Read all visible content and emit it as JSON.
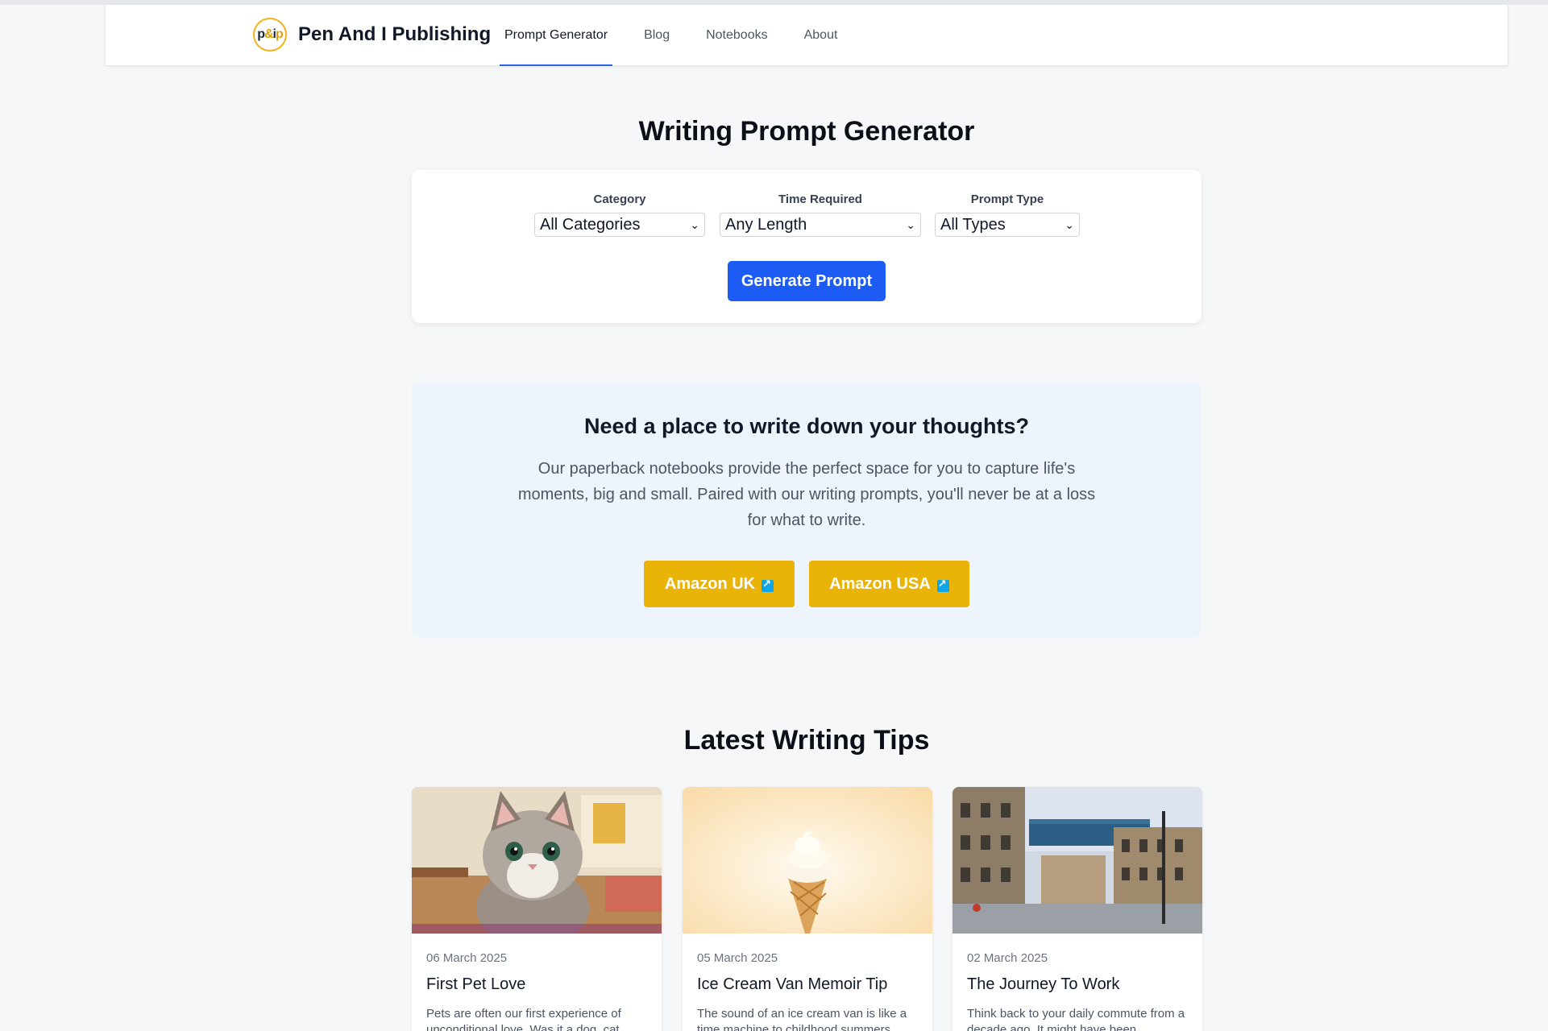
{
  "nav": {
    "logo_text": "p&ip",
    "brand": "Pen And I Publishing",
    "links": [
      {
        "label": "Prompt Generator",
        "active": true
      },
      {
        "label": "Blog",
        "active": false
      },
      {
        "label": "Notebooks",
        "active": false
      },
      {
        "label": "About",
        "active": false
      }
    ]
  },
  "generator": {
    "title": "Writing Prompt Generator",
    "filters": [
      {
        "label": "Category",
        "value": "All Categories"
      },
      {
        "label": "Time Required",
        "value": "Any Length"
      },
      {
        "label": "Prompt Type",
        "value": "All Types"
      }
    ],
    "button": "Generate Prompt"
  },
  "promo": {
    "title": "Need a place to write down your thoughts?",
    "text": "Our paperback notebooks provide the perfect space for you to capture life's moments, big and small. Paired with our writing prompts, you'll never be at a loss for what to write.",
    "buttons": [
      "Amazon UK",
      "Amazon USA"
    ]
  },
  "tips": {
    "title": "Latest Writing Tips",
    "posts": [
      {
        "date": "06 March 2025",
        "title": "First Pet Love",
        "excerpt": "Pets are often our first experience of unconditional love. Was it a dog, cat",
        "image": "cat-photo"
      },
      {
        "date": "05 March 2025",
        "title": "Ice Cream Van Memoir Tip",
        "excerpt": "The sound of an ice cream van is like a time machine to childhood summers",
        "image": "ice-cream-photo"
      },
      {
        "date": "02 March 2025",
        "title": "The Journey To Work",
        "excerpt": "Think back to your daily commute from a decade ago. It might have been",
        "image": "city-street-photo"
      }
    ]
  },
  "colors": {
    "primary": "#1d5cf4",
    "amazon": "#eab308",
    "background": "#f6f7f9",
    "promo_bg": "#eef4fb"
  }
}
